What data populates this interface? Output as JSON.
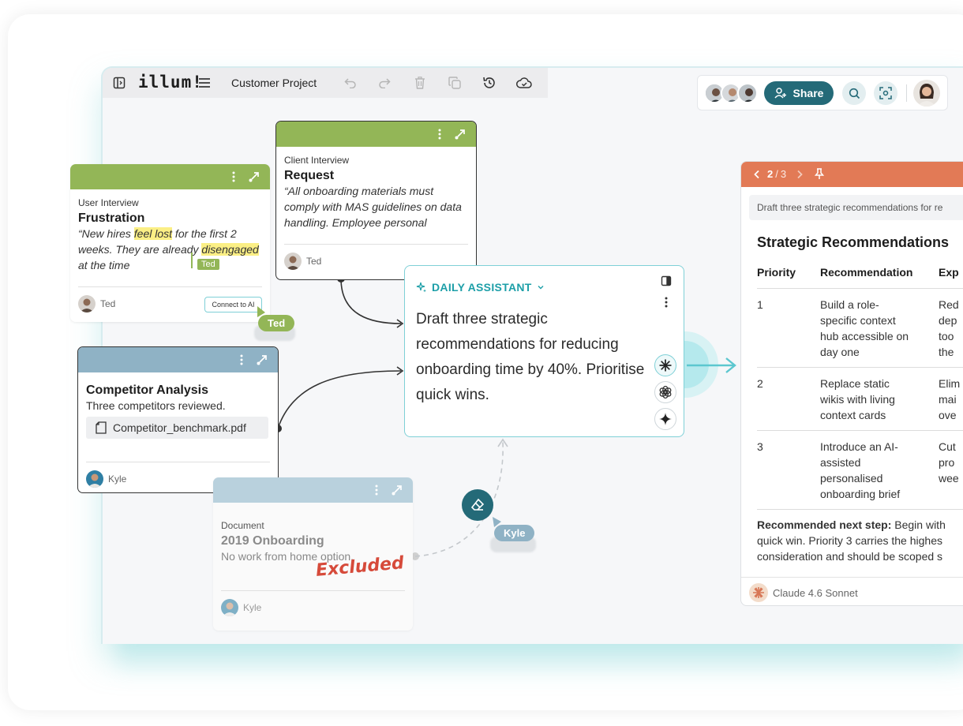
{
  "toolbar": {
    "logo": "illum!",
    "project_title": "Customer Project"
  },
  "header_right": {
    "share_label": "Share"
  },
  "cards": {
    "user_interview": {
      "type": "User Interview",
      "title": "Frustration",
      "quote_part1": "“New hires ",
      "quote_highlight1": "feel lost",
      "quote_part2": " for the first 2 weeks. They are already ",
      "quote_highlight2": "disengaged",
      "quote_part3": " at the time",
      "user": "Ted",
      "connect_label": "Connect to AI",
      "inline_tag": "Ted"
    },
    "client_interview": {
      "type": "Client Interview",
      "title": "Request",
      "quote": "“All onboarding materials must comply with MAS guidelines on data handling. Employee personal",
      "user": "Ted"
    },
    "competitor": {
      "title": "Competitor Analysis",
      "subtitle": "Three competitors reviewed.",
      "file_name": "Competitor_benchmark.pdf",
      "user": "Kyle"
    },
    "document": {
      "type": "Document",
      "title": "2019 Onboarding",
      "subtitle": "No work from home option.",
      "excluded_label": "Excluded",
      "user": "Kyle"
    }
  },
  "cursor_tags": {
    "ted": "Ted",
    "kyle": "Kyle"
  },
  "assistant": {
    "title": "DAILY ASSISTANT",
    "prompt": "Draft three strategic recommendations for reducing onboarding time by 40%. Prioritise quick wins."
  },
  "output": {
    "pager_current": "2",
    "pager_sep": "/",
    "pager_total": "3",
    "prompt_preview": "Draft three strategic recommendations for re",
    "title": "Strategic Recommendations",
    "columns": [
      "Priority",
      "Recommendation",
      "Exp"
    ],
    "rows": [
      {
        "priority": "1",
        "rec": [
          "Build a role-",
          "specific context",
          "hub accessible on",
          "day one"
        ],
        "exp": [
          "Red",
          "dep",
          "too",
          "the"
        ]
      },
      {
        "priority": "2",
        "rec": [
          "Replace static",
          "wikis with living",
          "context cards"
        ],
        "exp": [
          "Elim",
          "mai",
          "ove"
        ]
      },
      {
        "priority": "3",
        "rec": [
          "Introduce an AI-",
          "assisted",
          "personalised",
          "onboarding brief"
        ],
        "exp": [
          "Cut",
          "pro",
          "wee"
        ]
      }
    ],
    "next_step_label": "Recommended next step:",
    "next_step_line1": " Begin with",
    "next_step_line2": "quick win. Priority 3 carries the highes",
    "next_step_line3": "consideration and should be scoped s",
    "model_name": "Claude 4.6 Sonnet"
  },
  "colors": {
    "green": "#93b657",
    "blue": "#8fb2c5",
    "blue_faded": "#b9d1dd",
    "teal": "#246a78",
    "orange": "#e27a56",
    "assistant_border": "#7fd0d7",
    "excluded_red": "#d64a3a"
  }
}
